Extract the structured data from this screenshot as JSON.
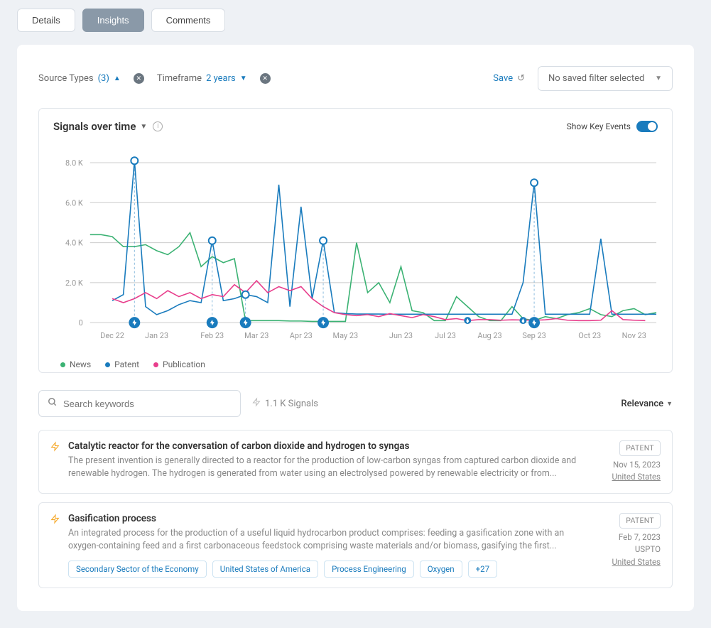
{
  "tabs": {
    "details": "Details",
    "insights": "Insights",
    "comments": "Comments"
  },
  "filters": {
    "source_types_label": "Source Types",
    "source_types_count": "(3)",
    "timeframe_label": "Timeframe",
    "timeframe_value": "2 years",
    "save_label": "Save",
    "saved_filter_placeholder": "No saved filter selected"
  },
  "chart": {
    "title": "Signals over time",
    "key_events_label": "Show Key Events",
    "legend": {
      "news": "News",
      "patent": "Patent",
      "publication": "Publication"
    }
  },
  "chart_data": {
    "type": "line",
    "title": "Signals over time",
    "xlabel": "",
    "ylabel": "",
    "ylim": [
      0,
      8500
    ],
    "y_ticks": [
      0,
      2000,
      4000,
      6000,
      8000
    ],
    "y_tick_labels": [
      "0",
      "2.0 K",
      "4.0 K",
      "6.0 K",
      "8.0 K"
    ],
    "x_labels": [
      "Dec 22",
      "Jan 23",
      "Feb 23",
      "Mar 23",
      "Apr 23",
      "May 23",
      "Jun 23",
      "Jul 23",
      "Aug 23",
      "Sep 23",
      "Oct 23",
      "Nov 23"
    ],
    "x": [
      0,
      1,
      2,
      3,
      4,
      5,
      6,
      7,
      8,
      9,
      10,
      11,
      12,
      13,
      14,
      15,
      16,
      17,
      18,
      19,
      20,
      21,
      22,
      23,
      24,
      25,
      26,
      27,
      28,
      29,
      30,
      31,
      32,
      33,
      34,
      35,
      36,
      37,
      38,
      39,
      40,
      41,
      42,
      43,
      44,
      45,
      46,
      47,
      48,
      49,
      50,
      51
    ],
    "series": [
      {
        "name": "News",
        "color": "#3bb273",
        "values": [
          4400,
          4400,
          4300,
          3800,
          3800,
          3900,
          3600,
          3400,
          3800,
          4500,
          2800,
          3300,
          3000,
          3200,
          100,
          100,
          100,
          100,
          80,
          80,
          60,
          60,
          60,
          60,
          4000,
          1500,
          2000,
          1000,
          2800,
          600,
          500,
          100,
          100,
          1300,
          800,
          300,
          100,
          100,
          800,
          200,
          100,
          300,
          200,
          400,
          500,
          700,
          400,
          300,
          600,
          700,
          400,
          500
        ]
      },
      {
        "name": "Patent",
        "color": "#197bbd",
        "values": [
          null,
          null,
          1100,
          1400,
          8100,
          800,
          400,
          600,
          900,
          1100,
          1000,
          4100,
          1100,
          1200,
          1400,
          1300,
          1000,
          6900,
          800,
          5800,
          1200,
          4100,
          500,
          450,
          430,
          430,
          430,
          420,
          420,
          420,
          420,
          420,
          420,
          420,
          420,
          420,
          420,
          420,
          420,
          2000,
          7000,
          420,
          420,
          420,
          420,
          420,
          4200,
          420,
          420,
          420,
          420,
          420
        ]
      },
      {
        "name": "Publication",
        "color": "#e83e8c",
        "values": [
          null,
          null,
          1200,
          1000,
          1200,
          1500,
          1200,
          1600,
          1300,
          1500,
          1200,
          1400,
          1300,
          1900,
          1500,
          2100,
          1500,
          1800,
          1600,
          1800,
          1200,
          800,
          500,
          400,
          350,
          400,
          300,
          450,
          350,
          250,
          400,
          300,
          150,
          200,
          100,
          150,
          150,
          120,
          140,
          130,
          120,
          140,
          200,
          120,
          100,
          100,
          120,
          600,
          150,
          120,
          100,
          null
        ]
      }
    ],
    "key_events": [
      {
        "x": 4,
        "y": 8100
      },
      {
        "x": 11,
        "y": 4100
      },
      {
        "x": 14,
        "y": 1400
      },
      {
        "x": 21,
        "y": 4100
      },
      {
        "x": 40,
        "y": 7000
      }
    ],
    "small_events_x": [
      34,
      39
    ]
  },
  "search": {
    "placeholder": "Search keywords",
    "count": "1.1 K Signals",
    "sort_label": "Relevance"
  },
  "results": [
    {
      "title": "Catalytic reactor for the conversation of carbon dioxide and hydrogen to syngas",
      "description": "The present invention is generally directed to a reactor for the production of low-carbon syngas from captured carbon dioxide and renewable hydrogen. The hydrogen is generated from water using an electrolysed powered by renewable electricity or from...",
      "badge": "PATENT",
      "date": "Nov 15, 2023",
      "source": "",
      "location": "United States",
      "tags": []
    },
    {
      "title": "Gasification process",
      "description": "An integrated process for the production of a useful liquid hydrocarbon product comprises: feeding a gasification zone with an oxygen-containing feed and a first carbonaceous feedstock comprising waste materials and/or biomass, gasifying the first...",
      "badge": "PATENT",
      "date": "Feb 7, 2023",
      "source": "USPTO",
      "location": "United States",
      "tags": [
        "Secondary Sector of the Economy",
        "United States of America",
        "Process Engineering",
        "Oxygen",
        "+27"
      ]
    }
  ]
}
